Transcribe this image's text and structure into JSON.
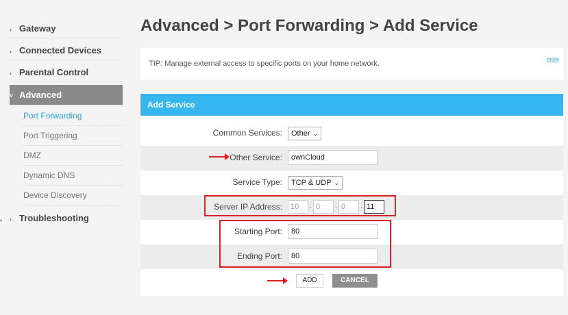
{
  "sidebar": {
    "items": [
      {
        "label": "Gateway"
      },
      {
        "label": "Connected Devices"
      },
      {
        "label": "Parental Control"
      },
      {
        "label": "Advanced"
      },
      {
        "label": "Troubleshooting"
      }
    ],
    "subitems": [
      {
        "label": "Port Forwarding"
      },
      {
        "label": "Port Triggering"
      },
      {
        "label": "DMZ"
      },
      {
        "label": "Dynamic DNS"
      },
      {
        "label": "Device Discovery"
      }
    ]
  },
  "header": {
    "title": "Advanced > Port Forwarding > Add Service"
  },
  "tip": {
    "text": "TIP: Manage external access to specific ports on your home network.",
    "more": "more"
  },
  "form": {
    "title": "Add Service",
    "common_services_label": "Common Services:",
    "common_services_value": "Other",
    "other_service_label": "Other Service:",
    "other_service_value": "ownCloud",
    "service_type_label": "Service Type:",
    "service_type_value": "TCP & UDP",
    "server_ip_label": "Server IP Address:",
    "ip": [
      "10",
      "0",
      "0",
      "11"
    ],
    "starting_port_label": "Starting Port:",
    "starting_port_value": "80",
    "ending_port_label": "Ending Port:",
    "ending_port_value": "80",
    "add_label": "ADD",
    "cancel_label": "CANCEL"
  },
  "colors": {
    "accent": "#35b6ee",
    "annotation": "#d91f1f",
    "active_nav": "#8a8a8a"
  }
}
